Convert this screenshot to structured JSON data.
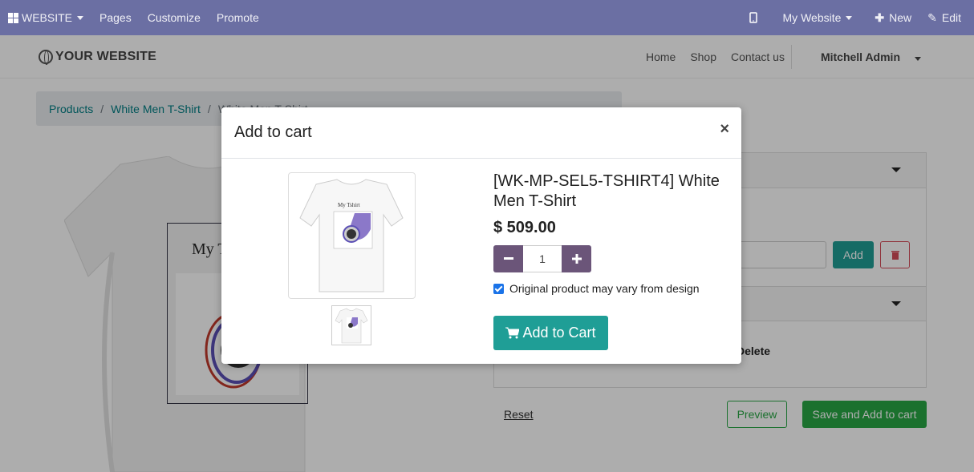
{
  "topbar": {
    "brand": "WEBSITE",
    "menu": [
      "Pages",
      "Customize",
      "Promote"
    ],
    "site_selector": "My Website",
    "new_label": "New",
    "edit_label": "Edit"
  },
  "header": {
    "logo": "YOUR WEBSITE",
    "nav": [
      "Home",
      "Shop",
      "Contact us"
    ],
    "user": "Mitchell Admin"
  },
  "breadcrumb": {
    "items": [
      "Products",
      "White Men T-Shirt",
      "White Men T-Shirt"
    ]
  },
  "background_panel": {
    "add_label": "Add",
    "delete_label": "Delete",
    "reset_label": "Reset",
    "preview_label": "Preview",
    "save_label": "Save and Add to cart"
  },
  "modal": {
    "title": "Add to cart",
    "close": "×",
    "product_name": "[WK-MP-SEL5-TSHIRT4] White Men T-Shirt",
    "price": "$ 509.00",
    "quantity": "1",
    "checkbox_label": "Original product may vary from design",
    "checkbox_checked": true,
    "add_to_cart_label": "Add to Cart",
    "image_text": "My Tshirt"
  },
  "colors": {
    "topbar": "#6b6fa3",
    "accent": "#1f9e96",
    "qty": "#6b5579",
    "success": "#28a745"
  }
}
